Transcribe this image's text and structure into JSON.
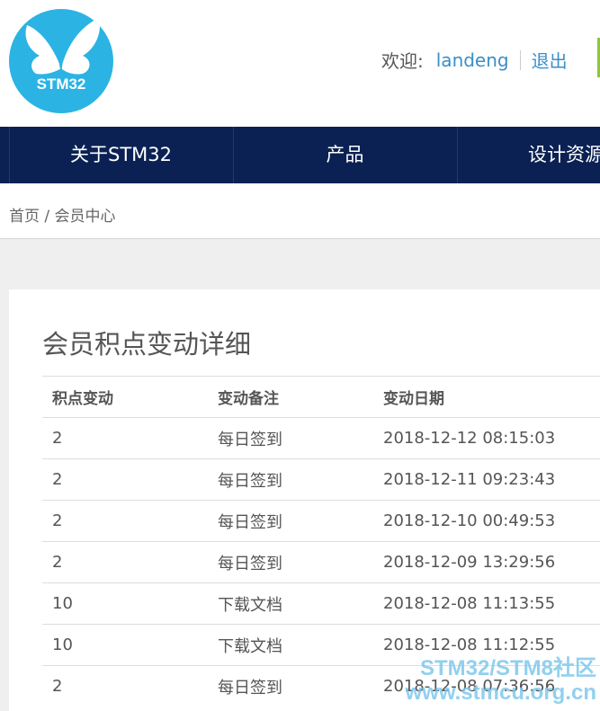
{
  "header": {
    "logo_text": "STM32",
    "welcome_label": "欢迎:",
    "username": "landeng",
    "logout_label": "退出"
  },
  "nav": {
    "items": [
      {
        "label": "关于STM32"
      },
      {
        "label": "产品"
      },
      {
        "label": "设计资源"
      }
    ]
  },
  "breadcrumb": {
    "home": "首页",
    "separator": "/",
    "current": "会员中心"
  },
  "panel": {
    "title": "会员积点变动详细",
    "columns": [
      "积点变动",
      "变动备注",
      "变动日期"
    ],
    "rows": [
      {
        "points": "2",
        "note": "每日签到",
        "date": "2018-12-12 08:15:03"
      },
      {
        "points": "2",
        "note": "每日签到",
        "date": "2018-12-11 09:23:43"
      },
      {
        "points": "2",
        "note": "每日签到",
        "date": "2018-12-10 00:49:53"
      },
      {
        "points": "2",
        "note": "每日签到",
        "date": "2018-12-09 13:29:56"
      },
      {
        "points": "10",
        "note": "下载文档",
        "date": "2018-12-08 11:13:55"
      },
      {
        "points": "10",
        "note": "下载文档",
        "date": "2018-12-08 11:12:55"
      },
      {
        "points": "2",
        "note": "每日签到",
        "date": "2018-12-08 07:36:56"
      }
    ]
  },
  "watermark": {
    "line1": "STM32/STM8社区",
    "line2": "www.stmcu.org.cn"
  },
  "colors": {
    "nav_bg": "#0b2153",
    "logo_bg": "#2bb3e4",
    "link": "#3a8fc7",
    "accent_green": "#8cc63f"
  },
  "icons": {
    "logo": "butterfly-icon"
  }
}
